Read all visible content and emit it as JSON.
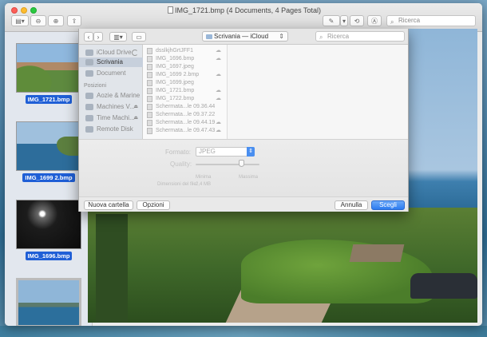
{
  "window": {
    "title": "IMG_1721.bmp (4 Documents, 4 Pages Total)",
    "search_placeholder": "Ricerca"
  },
  "thumbnails": [
    {
      "label": "IMG_1721.bmp"
    },
    {
      "label": "IMG_1699 2.bmp"
    },
    {
      "label": "IMG_1696.bmp"
    },
    {
      "label": ""
    }
  ],
  "dialog": {
    "location": "Scrivania — iCloud",
    "search_placeholder": "Ricerca",
    "sidebar": {
      "items": [
        {
          "label": "iCloud Drive"
        },
        {
          "label": "Scrivania"
        },
        {
          "label": "Document"
        }
      ],
      "section_locations": "Posizioni",
      "locations": [
        {
          "label": "Aozie & Marine"
        },
        {
          "label": "Machines V..."
        },
        {
          "label": "Time Machi..."
        },
        {
          "label": "Remote Disk"
        }
      ]
    },
    "files": [
      {
        "name": "dsslkjhGrtJFF1",
        "cloud": true
      },
      {
        "name": "IMG_1696.bmp",
        "cloud": true
      },
      {
        "name": "IMG_1697.jpeg",
        "cloud": false
      },
      {
        "name": "IMG_1699 2.bmp",
        "cloud": true
      },
      {
        "name": "IMG_1699.jpeg",
        "cloud": false
      },
      {
        "name": "IMG_1721.bmp",
        "cloud": true
      },
      {
        "name": "IMG_1722.bmp",
        "cloud": true
      },
      {
        "name": "Schermata...le 09.36.44",
        "cloud": false
      },
      {
        "name": "Schermata...le 09.37.22",
        "cloud": false
      },
      {
        "name": "Schermata...le 09.44.19",
        "cloud": true
      },
      {
        "name": "Schermata...le 09.47.43",
        "cloud": true
      }
    ],
    "options": {
      "format_label": "Formato:",
      "format_value": "JPEG",
      "quality_label": "Quality:",
      "quality_min": "Minima",
      "quality_max": "Massima",
      "quality_level": 0.72,
      "size_label": "Dimensioni del file:",
      "size_value": "2,4 MB"
    },
    "footer": {
      "new_folder": "Nuova cartella",
      "options": "Opzioni",
      "cancel": "Annulla",
      "choose": "Scegli"
    }
  }
}
